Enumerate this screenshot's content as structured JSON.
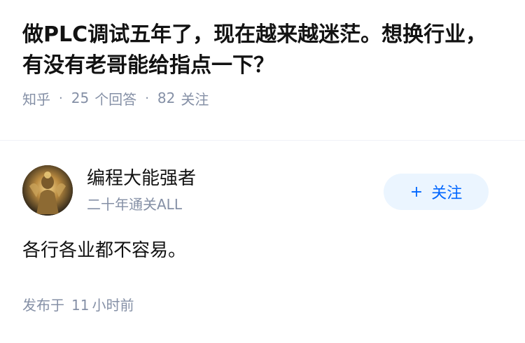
{
  "question": {
    "title": "做PLC调试五年了，现在越来越迷茫。想换行业，有没有老哥能给指点一下？",
    "source": "知乎",
    "answers_count": "25",
    "answers_label": "个回答",
    "followers_count": "82",
    "followers_label": "关注",
    "separator": "·"
  },
  "author": {
    "avatar_icon": "avatar-image",
    "name": "编程大能强者",
    "bio": "二十年通关ALL",
    "follow_plus": "+",
    "follow_label": "关注",
    "follow_color": "#0066ff",
    "follow_bg": "#ebf5ff"
  },
  "answer": {
    "content": "各行各业都不容易。",
    "published_prefix": "发布于",
    "published_num": "11",
    "published_suffix": "小时前"
  },
  "colors": {
    "text_primary": "#121212",
    "text_secondary": "#8590a6",
    "divider": "#f0f2f7"
  }
}
